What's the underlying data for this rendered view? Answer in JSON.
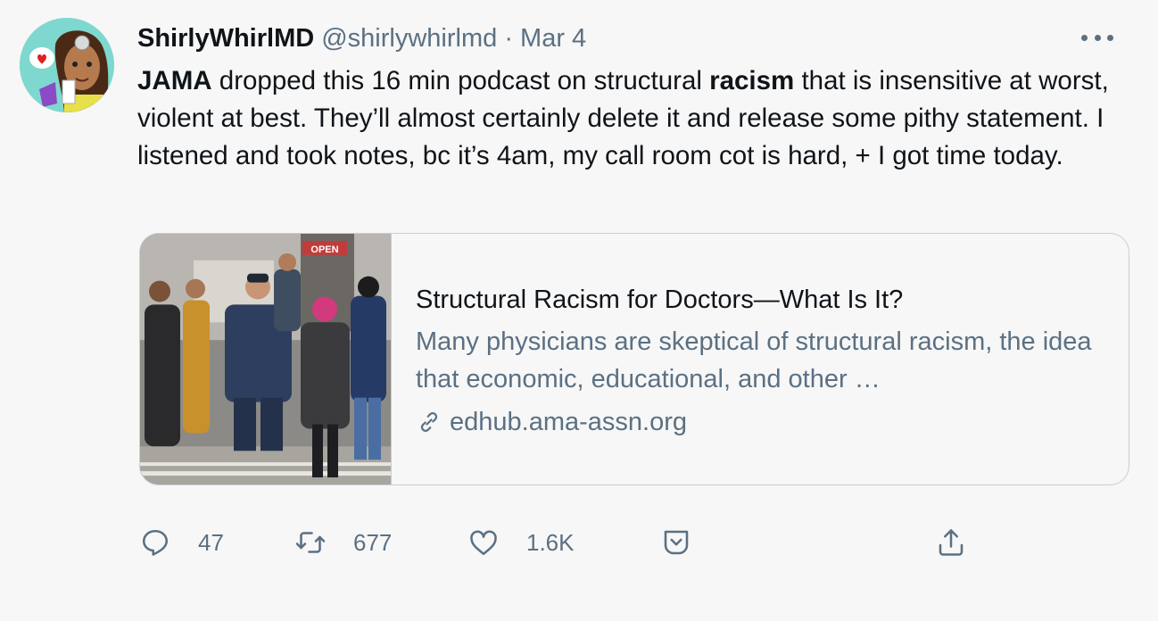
{
  "tweet": {
    "display_name": "ShirlyWhirlMD",
    "handle": "@shirlywhirlmd",
    "separator": "·",
    "date": "Mar 4",
    "text_parts": [
      {
        "text": "JAMA",
        "bold": true
      },
      {
        "text": " dropped this 16 min podcast on structural ",
        "bold": false
      },
      {
        "text": "racism",
        "bold": true
      },
      {
        "text": " that is insensitive at worst, violent at best. They’ll almost certainly delete it and release some pithy statement. I listened and took notes, bc it’s 4am, my call room cot is hard, + I got time today.",
        "bold": false
      }
    ]
  },
  "card": {
    "title": "Structural Racism for Doctors—What Is It?",
    "description": "Many physicians are skeptical of structural racism, the idea that economic, educational, and other …",
    "domain": "edhub.ama-assn.org",
    "image_sign": "OPEN",
    "icon": "link-icon"
  },
  "actions": {
    "reply_count": "47",
    "retweet_count": "677",
    "like_count": "1.6K",
    "icons": [
      "reply-icon",
      "retweet-icon",
      "like-icon",
      "revue-icon",
      "share-icon"
    ]
  },
  "colors": {
    "text": "#0f1419",
    "secondary": "#5b7083",
    "border": "#c4cfd6",
    "background": "#f7f7f7",
    "avatar_bg": "#7fd8cf"
  }
}
